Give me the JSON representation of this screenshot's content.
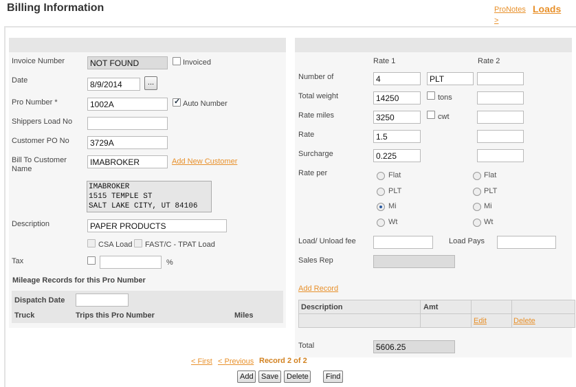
{
  "page": {
    "title": "Billing Information",
    "links": {
      "pronotes": "ProNotes",
      "loads": "Loads",
      "arrow": ">"
    }
  },
  "left": {
    "invoice_number": {
      "label": "Invoice Number",
      "value": "NOT FOUND",
      "invoiced_label": "Invoiced",
      "invoiced": false
    },
    "date": {
      "label": "Date",
      "value": "8/9/2014",
      "picker": "..."
    },
    "pro_number": {
      "label": "Pro Number *",
      "value": "1002A",
      "auto_label": "Auto Number",
      "auto": true
    },
    "shippers_load": {
      "label": "Shippers Load No",
      "value": ""
    },
    "customer_po": {
      "label": "Customer PO No",
      "value": "3729A"
    },
    "bill_to": {
      "label_line1": "Bill To Customer",
      "label_line2": "Name",
      "value": "IMABROKER",
      "add_link": "Add New Customer"
    },
    "address": "IMABROKER\n1515 TEMPLE ST\nSALT LAKE CITY, UT 84106",
    "description": {
      "label": "Description",
      "value": "PAPER PRODUCTS"
    },
    "csa_label": "CSA Load",
    "fast_label": "FAST/C - TPAT Load",
    "tax": {
      "label": "Tax",
      "value": "",
      "unit": "%"
    },
    "mileage": {
      "heading": "Mileage Records for this Pro Number",
      "dispatch_label": "Dispatch Date",
      "dispatch_value": "",
      "col_truck": "Truck",
      "col_trips": "Trips this Pro Number",
      "col_miles": "Miles"
    }
  },
  "right": {
    "rate1_header": "Rate 1",
    "rate2_header": "Rate 2",
    "number_of": {
      "label": "Number of",
      "rate1": "4",
      "unit": "PLT",
      "rate2": ""
    },
    "total_weight": {
      "label": "Total weight",
      "rate1": "14250",
      "tons_label": "tons",
      "rate2": ""
    },
    "rate_miles": {
      "label": "Rate miles",
      "rate1": "3250",
      "cwt_label": "cwt",
      "rate2": ""
    },
    "rate": {
      "label": "Rate",
      "rate1": "1.5",
      "rate2": ""
    },
    "surcharge": {
      "label": "Surcharge",
      "rate1": "0.225",
      "rate2": ""
    },
    "rate_per": {
      "label": "Rate per",
      "options": [
        "Flat",
        "PLT",
        "Mi",
        "Wt"
      ],
      "selected1": "Mi",
      "selected2": ""
    },
    "load_fee": {
      "label": "Load/ Unload fee",
      "value": "",
      "pays_label": "Load Pays",
      "pays_value": ""
    },
    "sales_rep": {
      "label": "Sales Rep",
      "value": ""
    },
    "add_record": "Add Record",
    "records": {
      "col_description": "Description",
      "col_amt": "Amt",
      "edit": "Edit",
      "delete": "Delete"
    },
    "total": {
      "label": "Total",
      "value": "5606.25"
    }
  },
  "nav": {
    "first": "< First",
    "previous": "< Previous",
    "record": "Record 2 of 2"
  },
  "buttons": {
    "add": "Add",
    "save": "Save",
    "delete": "Delete",
    "find": "Find"
  }
}
